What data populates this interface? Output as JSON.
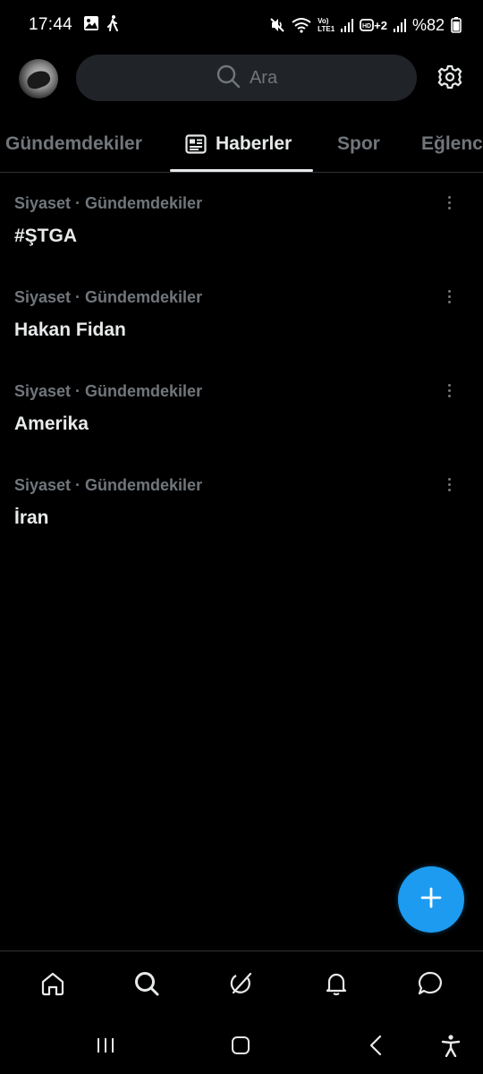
{
  "status_bar": {
    "time": "17:44",
    "battery_text": "%82",
    "network_label_top": "Vo)",
    "network_label_bottom": "LTE1",
    "sim2_label": "+2"
  },
  "header": {
    "search_placeholder": "Ara"
  },
  "tabs": [
    {
      "label": "Gündemdekiler",
      "active": false
    },
    {
      "label": "Haberler",
      "active": true
    },
    {
      "label": "Spor",
      "active": false
    },
    {
      "label": "Eğlence",
      "active": false
    }
  ],
  "trends": [
    {
      "meta": "Siyaset · Gündemdekiler",
      "title": "#ŞTGA"
    },
    {
      "meta": "Siyaset · Gündemdekiler",
      "title": "Hakan Fidan"
    },
    {
      "meta": "Siyaset · Gündemdekiler",
      "title": "Amerika"
    },
    {
      "meta": "Siyaset · Gündemdekiler",
      "title": "İran"
    }
  ],
  "bottom_nav": [
    "home-icon",
    "search-icon",
    "grok-icon",
    "bell-icon",
    "messages-icon"
  ],
  "colors": {
    "accent": "#1d9bf0",
    "background": "#000000",
    "text_primary": "#e7e9ea",
    "text_secondary": "#71767b",
    "divider": "#2f3336"
  }
}
